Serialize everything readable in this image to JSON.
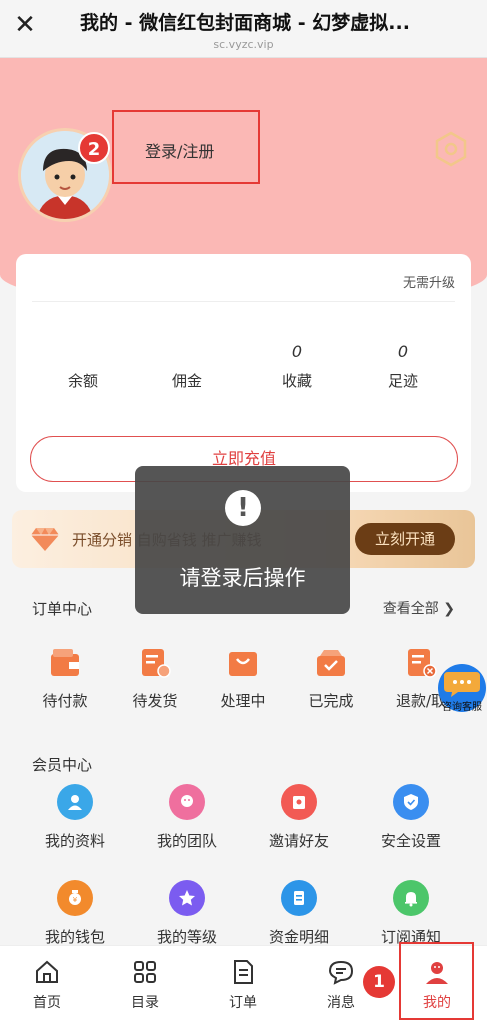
{
  "browser": {
    "title": "我的 - 微信红包封面商城 - 幻梦虚拟...",
    "url": "sc.vyzc.vip"
  },
  "profile": {
    "login_label": "登录/注册",
    "annotation_badge": "2"
  },
  "account": {
    "upgrade_label": "无需升级",
    "stats": [
      {
        "value": "",
        "label": "余额"
      },
      {
        "value": "",
        "label": "佣金"
      },
      {
        "value": "0",
        "label": "收藏"
      },
      {
        "value": "0",
        "label": "足迹"
      }
    ],
    "recharge_label": "立即充值"
  },
  "vip": {
    "text": "开通分销 自购省钱 推广赚钱",
    "button_label": "立刻开通"
  },
  "orders": {
    "title": "订单中心",
    "view_all": "查看全部 ❯",
    "items": [
      {
        "label": "待付款",
        "icon": "wallet-icon"
      },
      {
        "label": "待发货",
        "icon": "delivery-icon"
      },
      {
        "label": "处理中",
        "icon": "bag-icon"
      },
      {
        "label": "已完成",
        "icon": "box-check-icon"
      },
      {
        "label": "退款/取",
        "icon": "refund-icon"
      }
    ]
  },
  "member": {
    "title": "会员中心",
    "items": [
      {
        "label": "我的资料",
        "icon": "user-icon",
        "color": "#3aa7e8"
      },
      {
        "label": "我的团队",
        "icon": "team-icon",
        "color": "#ef6f9e"
      },
      {
        "label": "邀请好友",
        "icon": "invite-icon",
        "color": "#f25a54"
      },
      {
        "label": "安全设置",
        "icon": "shield-icon",
        "color": "#3a8ef0"
      },
      {
        "label": "我的钱包",
        "icon": "wallet-coin-icon",
        "color": "#f28a2c"
      },
      {
        "label": "我的等级",
        "icon": "star-icon",
        "color": "#7b5cf0"
      },
      {
        "label": "资金明细",
        "icon": "ledger-icon",
        "color": "#2c95e8"
      },
      {
        "label": "订阅通知",
        "icon": "bell-icon",
        "color": "#4cc66a"
      }
    ]
  },
  "toast": {
    "message": "请登录后操作",
    "icon": "exclamation-icon"
  },
  "chat": {
    "label": "咨询客服"
  },
  "tabbar": {
    "items": [
      {
        "label": "首页",
        "icon": "home-icon"
      },
      {
        "label": "目录",
        "icon": "grid-icon"
      },
      {
        "label": "订单",
        "icon": "order-icon"
      },
      {
        "label": "消息",
        "icon": "message-icon"
      },
      {
        "label": "我的",
        "icon": "profile-icon",
        "active": true
      }
    ],
    "annotation_badge": "1"
  },
  "colors": {
    "header_pink": "#fbb8b5",
    "accent_red": "#e04040",
    "vip_brown": "#6b3d15"
  }
}
